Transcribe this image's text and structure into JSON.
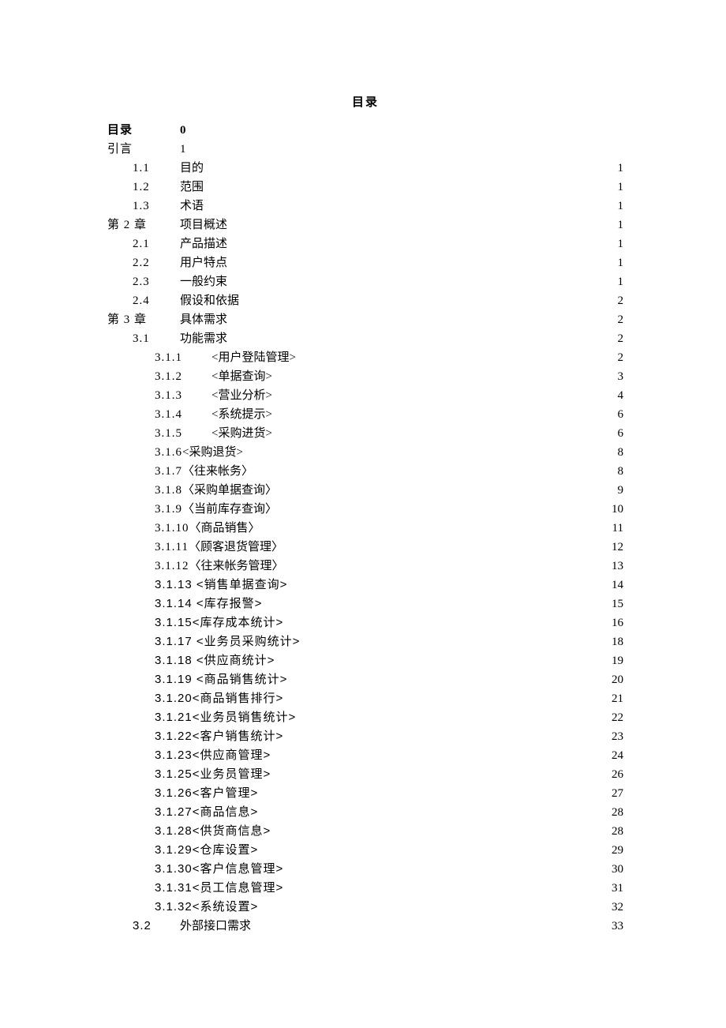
{
  "title": "目录",
  "toc": [
    {
      "num": "目录",
      "numClass": "lvl0-num bold",
      "label": "0",
      "labelClass": "",
      "leader": false,
      "page": "",
      "rowClass": "bold"
    },
    {
      "num": "引言",
      "numClass": "lvl0-num",
      "label": "1",
      "labelClass": "",
      "leader": false,
      "page": ""
    },
    {
      "num": "1.1",
      "numClass": "lvl1-num",
      "label": "目的",
      "leader": true,
      "page": "1"
    },
    {
      "num": "1.2",
      "numClass": "lvl1-num",
      "label": "范围",
      "leader": true,
      "page": "1"
    },
    {
      "num": "1.3",
      "numClass": "lvl1-num",
      "label": "术语",
      "leader": true,
      "page": "1"
    },
    {
      "num": "第 2 章",
      "numClass": "lvl0-num",
      "label": "项目概述",
      "leader": true,
      "page": "1"
    },
    {
      "num": "2.1",
      "numClass": "lvl1-num",
      "label": "产品描述",
      "leader": true,
      "page": "1"
    },
    {
      "num": "2.2",
      "numClass": "lvl1-num",
      "label": "用户特点",
      "leader": true,
      "page": "1"
    },
    {
      "num": "2.3",
      "numClass": "lvl1-num",
      "label": "一般约束",
      "leader": true,
      "page": "1"
    },
    {
      "num": "2.4",
      "numClass": "lvl1-num",
      "label": "假设和依据",
      "leader": true,
      "page": "2"
    },
    {
      "num": "第 3 章",
      "numClass": "lvl0-num",
      "label": "具体需求",
      "leader": true,
      "page": "2"
    },
    {
      "num": "3.1",
      "numClass": "lvl1-num",
      "label": "功能需求",
      "leader": true,
      "page": "2"
    },
    {
      "num": "3.1.1",
      "numClass": "lvl2-num",
      "label": "<用户登陆管理>",
      "leader": true,
      "page": "2"
    },
    {
      "num": "3.1.2",
      "numClass": "lvl2-num",
      "label": "<单据查询>",
      "leader": true,
      "page": "3"
    },
    {
      "num": "3.1.3",
      "numClass": "lvl2-num",
      "label": "<营业分析>",
      "leader": true,
      "page": "4"
    },
    {
      "num": "3.1.4",
      "numClass": "lvl2-num",
      "label": "<系统提示>",
      "leader": true,
      "page": "6"
    },
    {
      "num": "3.1.5",
      "numClass": "lvl2-num",
      "label": "<采购进货>",
      "leader": true,
      "page": "6"
    },
    {
      "num": "3.1.6",
      "numClass": "lvl2b-num",
      "label": " <采购退货>",
      "leader": true,
      "page": "8"
    },
    {
      "num": "3.1.7",
      "numClass": "lvl2b-num",
      "label": " 〈往来帐务〉",
      "leader": true,
      "page": "8"
    },
    {
      "num": "3.1.8",
      "numClass": "lvl2b-num",
      "label": " 〈采购单据查询〉",
      "leader": true,
      "page": "9"
    },
    {
      "num": "3.1.9",
      "numClass": "lvl2b-num",
      "label": " 〈当前库存查询〉",
      "leader": true,
      "page": "10"
    },
    {
      "num": "3.1.10",
      "numClass": "lvl2b-num",
      "label": " 〈商品销售〉",
      "leader": true,
      "page": "11"
    },
    {
      "num": "3.1.11",
      "numClass": "lvl2b-num",
      "label": " 〈顾客退货管理〉",
      "leader": true,
      "page": "12"
    },
    {
      "num": "3.1.12",
      "numClass": "lvl2b-num",
      "label": "  〈往来帐务管理〉",
      "leader": true,
      "page": "13"
    },
    {
      "num": "3.1.13 <销售单据查询>",
      "numClass": "lvl2b-num sans",
      "label": "",
      "leader": true,
      "page": "14"
    },
    {
      "num": "3.1.14 <库存报警>",
      "numClass": "lvl2b-num sans",
      "label": "",
      "leader": true,
      "page": "15"
    },
    {
      "num": "3.1.15<库存成本统计>",
      "numClass": "lvl2b-num sans",
      "label": "",
      "leader": true,
      "page": "16"
    },
    {
      "num": "3.1.17 <业务员采购统计> ",
      "numClass": "lvl2b-num sans",
      "label": "",
      "leader": true,
      "page": "18"
    },
    {
      "num": "3.1.18 <供应商统计> ",
      "numClass": "lvl2b-num sans",
      "label": "",
      "leader": true,
      "page": "19"
    },
    {
      "num": "3.1.19 <商品销售统计>",
      "numClass": "lvl2b-num sans",
      "label": "",
      "leader": true,
      "page": "20"
    },
    {
      "num": "3.1.20<商品销售排行>",
      "numClass": "lvl2b-num sans",
      "label": "",
      "leader": true,
      "page": "21"
    },
    {
      "num": "3.1.21<业务员销售统计>",
      "numClass": "lvl2b-num sans",
      "label": "",
      "leader": true,
      "page": "22"
    },
    {
      "num": "3.1.22<客户销售统计>",
      "numClass": "lvl2b-num sans",
      "label": "",
      "leader": true,
      "page": "23"
    },
    {
      "num": "3.1.23<供应商管理>",
      "numClass": "lvl2b-num sans",
      "label": "",
      "leader": true,
      "page": "24"
    },
    {
      "num": "3.1.25<业务员管理>",
      "numClass": "lvl2b-num sans",
      "label": "",
      "leader": true,
      "page": "26"
    },
    {
      "num": "3.1.26<客户管理>",
      "numClass": "lvl2b-num sans",
      "label": "",
      "leader": true,
      "page": "27"
    },
    {
      "num": "3.1.27<商品信息>",
      "numClass": "lvl2b-num sans",
      "label": "",
      "leader": true,
      "page": "28"
    },
    {
      "num": "3.1.28<供货商信息>",
      "numClass": "lvl2b-num sans",
      "label": "",
      "leader": true,
      "page": "28"
    },
    {
      "num": "3.1.29<仓库设置>",
      "numClass": "lvl2b-num sans",
      "label": "",
      "leader": true,
      "page": "29"
    },
    {
      "num": "3.1.30<客户信息管理>",
      "numClass": "lvl2b-num sans",
      "label": "",
      "leader": true,
      "page": "30"
    },
    {
      "num": "3.1.31<员工信息管理>",
      "numClass": "lvl2b-num sans",
      "label": "",
      "leader": true,
      "page": "31"
    },
    {
      "num": "3.1.32<系统设置>",
      "numClass": "lvl2b-num sans",
      "label": "",
      "leader": true,
      "page": "32"
    },
    {
      "num": "3.2",
      "numClass": "lvl1-num sans",
      "label": "外部接口需求",
      "labelClass": "sans",
      "leader": true,
      "page": "33"
    }
  ]
}
